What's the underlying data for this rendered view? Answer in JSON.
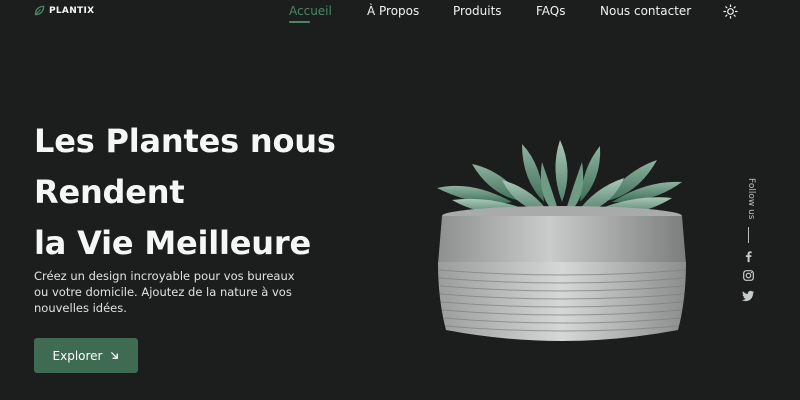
{
  "brand": {
    "name": "PLANTIX",
    "icon": "leaf-icon",
    "accent": "#4b8767"
  },
  "nav": {
    "items": [
      {
        "label": "Accueil",
        "active": true
      },
      {
        "label": "À Propos",
        "active": false
      },
      {
        "label": "Produits",
        "active": false
      },
      {
        "label": "FAQs",
        "active": false
      },
      {
        "label": "Nous contacter",
        "active": false
      }
    ],
    "theme_toggle_icon": "sun-icon"
  },
  "hero": {
    "title_lines": [
      "Les Plantes nous",
      "Rendent",
      "la Vie Meilleure"
    ],
    "description_lines": [
      "Créez un design incroyable pour vos bureaux",
      "ou votre domicile. Ajoutez de la nature à vos",
      "nouvelles idées."
    ],
    "cta_label": "Explorer",
    "cta_icon": "arrow-down-right-icon",
    "cta_color": "#3f6b53"
  },
  "social": {
    "label": "Follow us",
    "icons": [
      "facebook-icon",
      "instagram-icon",
      "twitter-icon"
    ]
  },
  "colors": {
    "background": "#1b1e1d",
    "text": "#f1f4f2"
  }
}
